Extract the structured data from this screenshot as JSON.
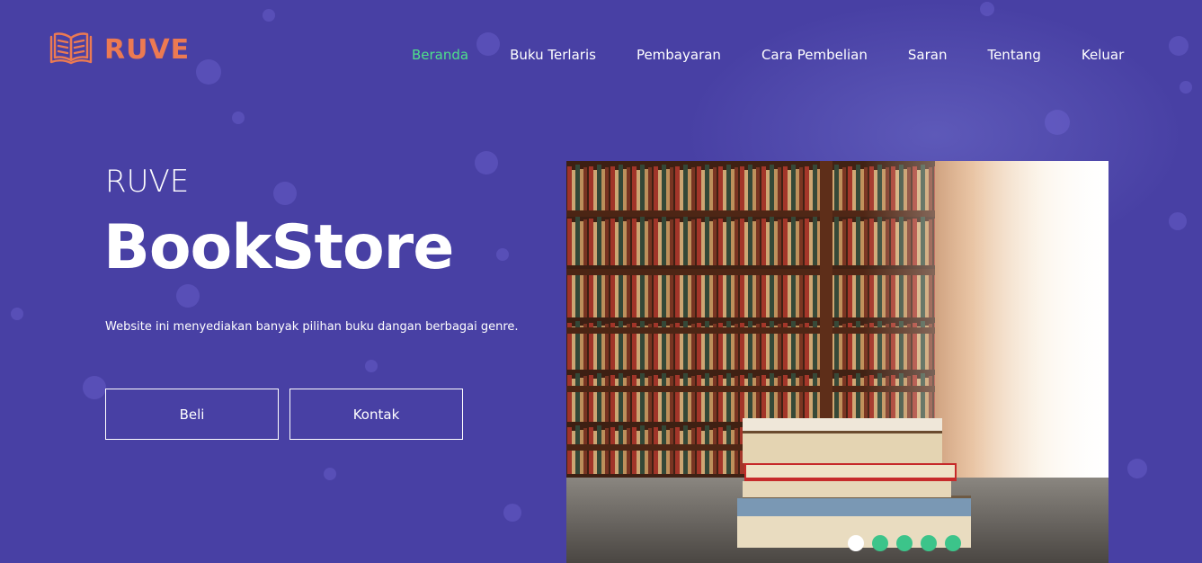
{
  "brand": {
    "name": "RUVE",
    "icon": "open-book-icon",
    "color": "#ec7a52"
  },
  "nav": [
    {
      "label": "Beranda",
      "active": true
    },
    {
      "label": "Buku Terlaris",
      "active": false
    },
    {
      "label": "Pembayaran",
      "active": false
    },
    {
      "label": "Cara Pembelian",
      "active": false
    },
    {
      "label": "Saran",
      "active": false
    },
    {
      "label": "Tentang",
      "active": false
    },
    {
      "label": "Keluar",
      "active": false
    }
  ],
  "hero": {
    "subtitle": "RUVE",
    "title": "BookStore",
    "description": "Website ini menyediakan banyak pilihan buku dangan berbagai genre.",
    "buttons": {
      "beli": "Beli",
      "kontak": "Kontak"
    }
  },
  "carousel": {
    "image": "library-bookshelves-with-book-stack",
    "slide_count": 5,
    "active_slide": 1
  },
  "colors": {
    "background": "#4840a4",
    "nav_active": "#4ee08a",
    "dot": "#3cc48a",
    "dot_active": "#ffffff"
  }
}
